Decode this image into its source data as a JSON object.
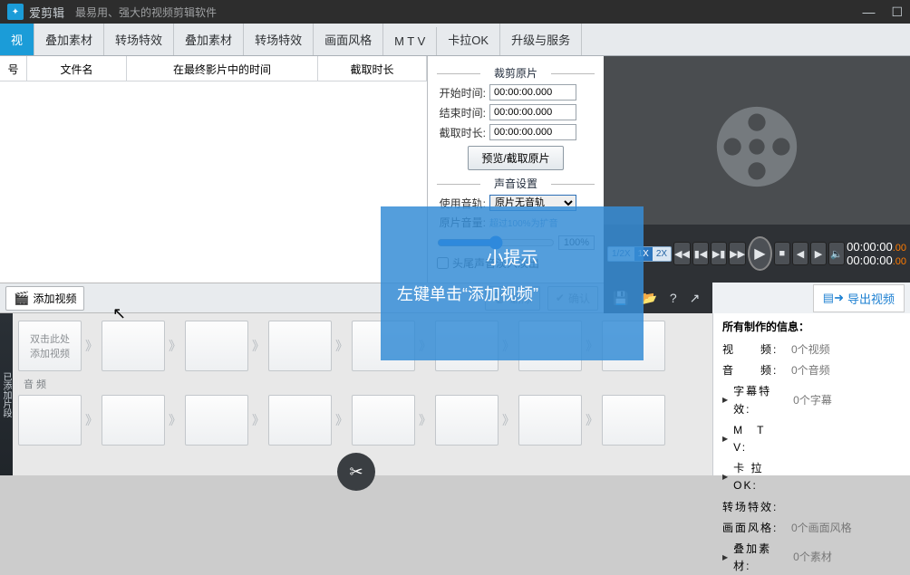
{
  "titlebar": {
    "app_name": "爱剪辑",
    "slogan": "最易用、强大的视频剪辑软件"
  },
  "tabs": [
    "视",
    "叠加素材",
    "转场特效",
    "叠加素材",
    "转场特效",
    "画面风格",
    "M T V",
    "卡拉OK",
    "升级与服务"
  ],
  "table_headers": {
    "seq": "号",
    "filename": "文件名",
    "time_in_final": "在最终影片中的时间",
    "clip_len": "截取时长"
  },
  "clip": {
    "section": "裁剪原片",
    "start_label": "开始时间:",
    "start_value": "00:00:00.000",
    "end_label": "结束时间:",
    "end_value": "00:00:00.000",
    "len_label": "截取时长:",
    "len_value": "00:00:00.000",
    "preview_btn": "预览/截取原片"
  },
  "audio": {
    "section": "声音设置",
    "track_label": "使用音轨:",
    "track_value": "原片无音轨",
    "vol_label": "原片音量:",
    "tip": "超过100%为扩音",
    "pct": "100%",
    "fade_label": "头尾声音淡入淡出"
  },
  "transport": {
    "speeds": [
      "1/2X",
      "1X",
      "2X"
    ],
    "tc1": "00:00:00",
    "tc1f": ".00",
    "tc2": "00:00:00",
    "tc2f": ".00"
  },
  "actions": {
    "add_video": "添加视频",
    "delete": "删除",
    "confirm": "确认",
    "export": "导出视频"
  },
  "timeline": {
    "first_slot": "双击此处\n添加视频",
    "audio_label": "音 频"
  },
  "info": {
    "title": "所有制作的信息：",
    "rows": [
      {
        "k": "视　　频:",
        "v": "0个视频"
      },
      {
        "k": "音　　频:",
        "v": "0个音频"
      },
      {
        "k": "字幕特效:",
        "v": "0个字幕"
      },
      {
        "k": "M　T　V:",
        "v": ""
      },
      {
        "k": "卡 拉 OK:",
        "v": ""
      },
      {
        "k": "转场特效:",
        "v": ""
      },
      {
        "k": "画面风格:",
        "v": "0个画面风格"
      },
      {
        "k": "叠加素材:",
        "v": "0个素材"
      }
    ]
  },
  "tooltip": {
    "title": "小提示",
    "body": "左键单击“添加视频”"
  }
}
